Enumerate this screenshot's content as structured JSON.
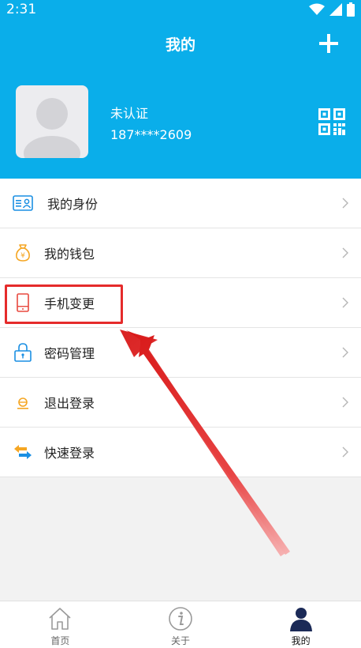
{
  "status_bar": {
    "time": "2:31"
  },
  "header": {
    "title": "我的"
  },
  "profile": {
    "status": "未认证",
    "phone": "187****2609"
  },
  "menu": {
    "items": [
      {
        "label": "我的身份",
        "icon": "id-card-icon"
      },
      {
        "label": "我的钱包",
        "icon": "wallet-icon"
      },
      {
        "label": "手机变更",
        "icon": "phone-icon"
      },
      {
        "label": "密码管理",
        "icon": "lock-icon"
      },
      {
        "label": "退出登录",
        "icon": "logout-icon"
      },
      {
        "label": "快速登录",
        "icon": "swap-icon"
      }
    ]
  },
  "tabbar": {
    "tabs": [
      {
        "label": "首页",
        "icon": "home-icon"
      },
      {
        "label": "关于",
        "icon": "info-icon"
      },
      {
        "label": "我的",
        "icon": "user-icon"
      }
    ],
    "active": "我的"
  },
  "colors": {
    "primary": "#0aaeea",
    "highlight": "#e52b2b",
    "icon_blue": "#1a8fe3",
    "icon_orange": "#f5a623",
    "icon_red": "#e8493f"
  }
}
